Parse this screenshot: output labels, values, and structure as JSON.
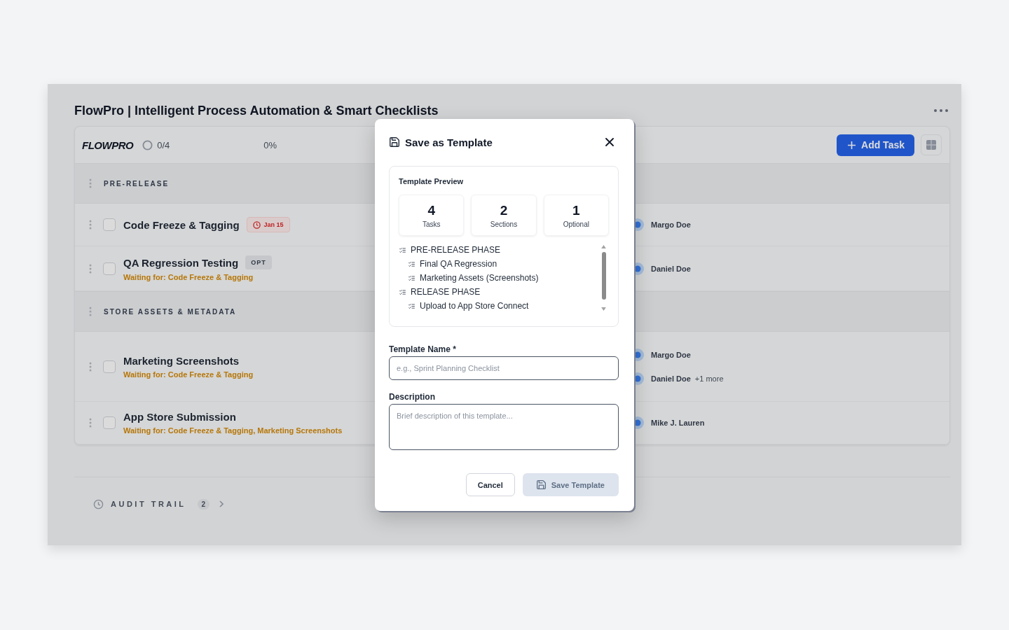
{
  "app": {
    "title": "FlowPro | Intelligent Process Automation & Smart Checklists",
    "toolbar": {
      "logo": "FLOWPRO",
      "progress_count": "0/4",
      "progress_percent": "0%",
      "add_button": "Add Task"
    },
    "sections": [
      {
        "title": "PRE-RELEASE",
        "tasks": [
          {
            "title": "Code Freeze & Tagging",
            "checked": false,
            "badge": {
              "kind": "due",
              "text": "Jan 15"
            },
            "assignees": [
              {
                "name": "Margo Doe"
              }
            ]
          },
          {
            "title": "QA Regression Testing",
            "checked": false,
            "badge": {
              "kind": "optional",
              "text": "OPT"
            },
            "waiting": "Waiting for: Code Freeze & Tagging",
            "assignees": [
              {
                "name": "Daniel Doe"
              }
            ]
          }
        ]
      },
      {
        "title": "STORE ASSETS & METADATA",
        "tasks": [
          {
            "title": "Marketing Screenshots",
            "checked": false,
            "waiting": "Waiting for: Code Freeze & Tagging",
            "assignees": [
              {
                "name": "Margo Doe"
              },
              {
                "name": "Daniel Doe"
              }
            ],
            "more_assignees": "+1 more"
          },
          {
            "title": "App Store Submission",
            "checked": false,
            "waiting": "Waiting for: Code Freeze & Tagging, Marketing Screenshots",
            "assignees": [
              {
                "name": "Mike J. Lauren"
              }
            ]
          }
        ]
      }
    ],
    "audit_trail": {
      "label": "AUDIT TRAIL",
      "count": "2"
    }
  },
  "modal": {
    "title": "Save as Template",
    "preview": {
      "heading": "Template Preview",
      "stats": [
        {
          "value": "4",
          "label": "Tasks"
        },
        {
          "value": "2",
          "label": "Sections"
        },
        {
          "value": "1",
          "label": "Optional"
        }
      ],
      "outline": [
        {
          "title": "PRE-RELEASE PHASE",
          "children": [
            {
              "title": "Final QA Regression"
            },
            {
              "title": "Marketing Assets (Screenshots)"
            }
          ]
        },
        {
          "title": "RELEASE PHASE",
          "children": [
            {
              "title": "Upload to App Store Connect"
            }
          ]
        }
      ]
    },
    "fields": [
      {
        "kind": "text",
        "label": "Template Name *",
        "placeholder": "e.g., Sprint Planning Checklist"
      },
      {
        "kind": "textarea",
        "label": "Description",
        "placeholder": "Brief description of this template..."
      }
    ],
    "actions": [
      {
        "kind": "cancel",
        "label": "Cancel",
        "disabled": false
      },
      {
        "kind": "save",
        "label": "Save Template",
        "disabled": true
      }
    ]
  }
}
